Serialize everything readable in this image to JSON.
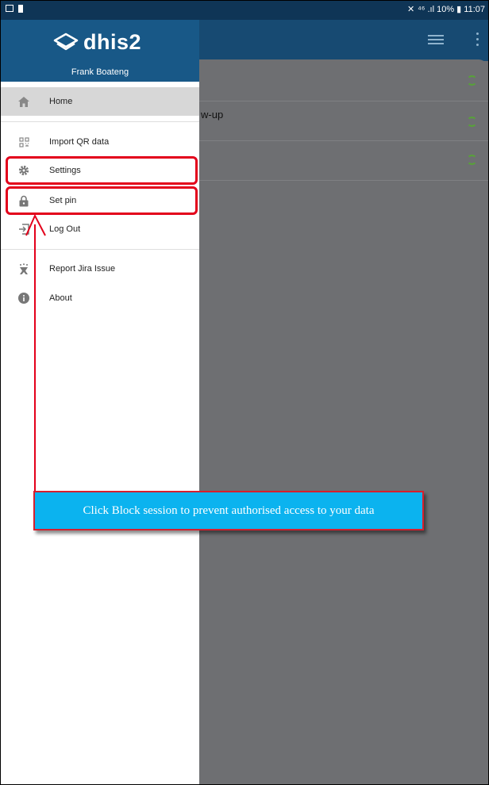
{
  "status_bar": {
    "right_text": "⁴⁶ .ıl 10% ▮ 11:07"
  },
  "background_app": {
    "rows": [
      {
        "text": ""
      },
      {
        "text": "w-up"
      },
      {
        "text": ""
      }
    ]
  },
  "drawer": {
    "logo_text": "dhis2",
    "user_name": "Frank Boateng",
    "items": [
      {
        "label": "Home",
        "icon": "home-icon"
      },
      {
        "label": "Import QR data",
        "icon": "qr-code-icon"
      },
      {
        "label": "Settings",
        "icon": "gear-icon"
      },
      {
        "label": "Set pin",
        "icon": "lock-icon"
      },
      {
        "label": "Log Out",
        "icon": "logout-icon"
      },
      {
        "label": "Report Jira Issue",
        "icon": "bug-icon"
      },
      {
        "label": "About",
        "icon": "info-icon"
      }
    ]
  },
  "annotation": {
    "note_text": "Click Block session to prevent authorised access to your data",
    "highlight_color": "#e3001b",
    "note_color": "#0bb3ef"
  }
}
